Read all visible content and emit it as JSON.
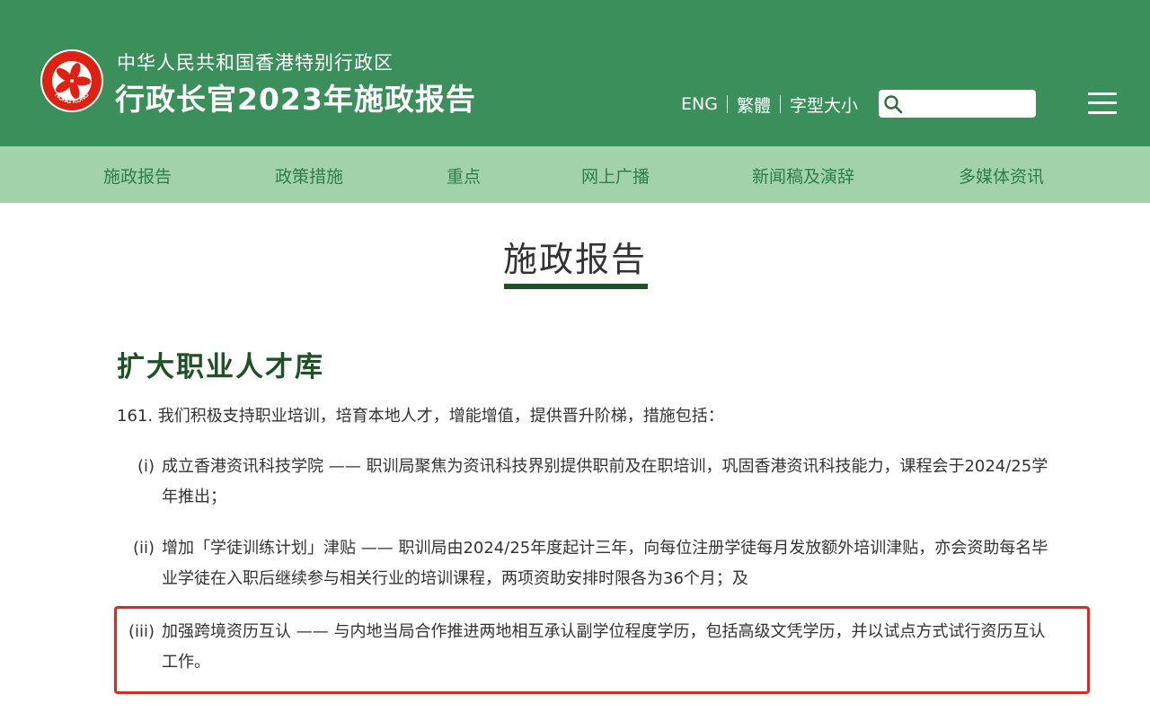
{
  "header": {
    "subtitle": "中华人民共和国香港特别行政区",
    "title": "行政长官2023年施政报告",
    "emblem_text": "HONG KONG",
    "bg_color": "#3a8f5a"
  },
  "utils": {
    "eng": "ENG",
    "trad": "繁體",
    "font_size": "字型大小",
    "search_placeholder": "",
    "search_value": ""
  },
  "nav": {
    "bg_color": "#a2d2a8",
    "items": [
      {
        "label": "施政报告"
      },
      {
        "label": "政策措施"
      },
      {
        "label": "重点"
      },
      {
        "label": "网上广播"
      },
      {
        "label": "新闻稿及演辞"
      },
      {
        "label": "多媒体资讯"
      }
    ]
  },
  "main": {
    "heading": "施政报告",
    "section_title": "扩大职业人才库",
    "paragraph": "161. 我们积极支持职业培训，培育本地人才，增能增值，提供晋升阶梯，措施包括：",
    "items": [
      {
        "num": "(i)",
        "text": "成立香港资讯科技学院 —— 职训局聚焦为资讯科技界别提供职前及在职培训，巩固香港资讯科技能力，课程会于2024/25学年推出；"
      },
      {
        "num": "(ii)",
        "text": "增加「学徒训练计划」津贴 —— 职训局由2024/25年度起计三年，向每位注册学徒每月发放额外培训津贴，亦会资助每名毕业学徒在入职后继续参与相关行业的培训课程，两项资助安排时限各为36个月；及"
      },
      {
        "num": "(iii)",
        "text": "加强跨境资历互认 —— 与内地当局合作推进两地相互承认副学位程度学历，包括高级文凭学历，并以试点方式试行资历互认工作。"
      }
    ],
    "highlight_color": "#e52520"
  }
}
